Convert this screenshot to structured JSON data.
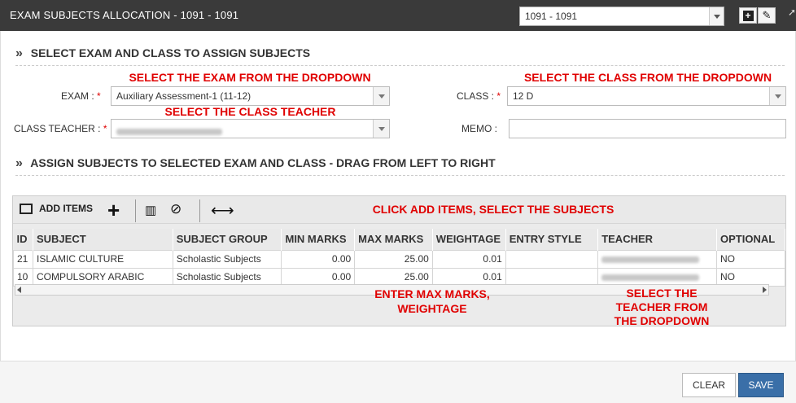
{
  "window": {
    "title": "EXAM SUBJECTS ALLOCATION - 1091 - 1091",
    "year_select": "1091 - 1091",
    "add_icon": "plus-square-icon",
    "edit_icon": "edit-icon"
  },
  "section1": {
    "chevron": "»",
    "title": "SELECT EXAM AND CLASS TO ASSIGN SUBJECTS"
  },
  "form": {
    "exam_label": "EXAM :",
    "exam_value": "Auxiliary Assessment-1 (11-12)",
    "class_label": "CLASS :",
    "class_value": "12 D",
    "teacher_label": "CLASS TEACHER :",
    "memo_label": "MEMO :",
    "memo_value": "",
    "required_mark": "*"
  },
  "section2": {
    "chevron": "»",
    "title": "ASSIGN SUBJECTS TO SELECTED EXAM AND CLASS - DRAG FROM LEFT TO RIGHT"
  },
  "toolbar": {
    "add_items_label": "ADD ITEMS",
    "plus": "+",
    "trash": "🗑",
    "ban": "⊘",
    "resize": "⟷"
  },
  "grid": {
    "columns": [
      "ID",
      "SUBJECT",
      "SUBJECT GROUP",
      "MIN MARKS",
      "MAX MARKS",
      "WEIGHTAGE",
      "ENTRY STYLE",
      "TEACHER",
      "OPTIONAL"
    ],
    "rows": [
      {
        "id": "21",
        "subject": "ISLAMIC CULTURE",
        "group": "Scholastic Subjects",
        "min": "0.00",
        "max": "25.00",
        "weight": "0.01",
        "entry": "",
        "optional": "NO"
      },
      {
        "id": "10",
        "subject": "COMPULSORY ARABIC",
        "group": "Scholastic Subjects",
        "min": "0.00",
        "max": "25.00",
        "weight": "0.01",
        "entry": "",
        "optional": "NO"
      }
    ]
  },
  "annotations": {
    "exam": "SELECT THE EXAM FROM THE DROPDOWN",
    "class": "SELECT THE CLASS FROM THE DROPDOWN",
    "teacher": "SELECT THE CLASS TEACHER",
    "add_items": "CLICK ADD ITEMS, SELECT THE SUBJECTS",
    "max_marks_line1": "ENTER MAX MARKS,",
    "max_marks_line2": "WEIGHTAGE",
    "teacher_dd_line1": "SELECT THE",
    "teacher_dd_line2": "TEACHER FROM",
    "teacher_dd_line3": "THE DROPDOWN"
  },
  "footer": {
    "clear_label": "CLEAR",
    "save_label": "SAVE"
  },
  "colors": {
    "titlebar": "#3a3a3a",
    "annotation": "#e00000",
    "save_button": "#3a6fa8"
  }
}
